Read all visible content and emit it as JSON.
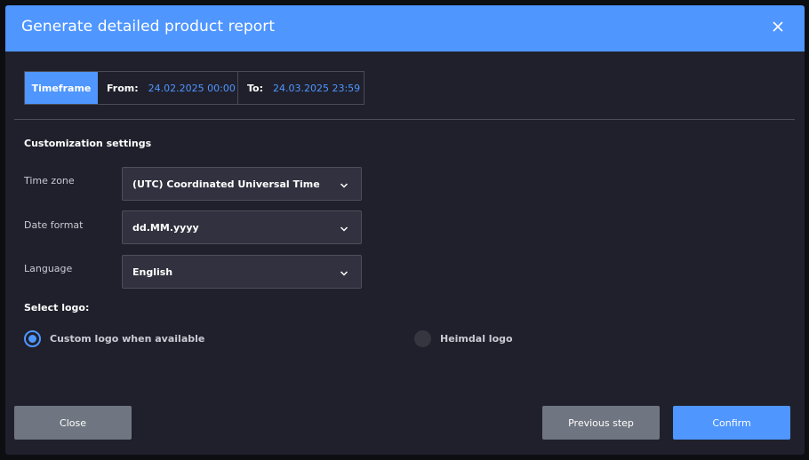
{
  "modal": {
    "title": "Generate detailed product report"
  },
  "timeframe": {
    "label": "Timeframe",
    "from_label": "From:",
    "from_value": "24.02.2025 00:00",
    "to_label": "To:",
    "to_value": "24.03.2025 23:59"
  },
  "customization": {
    "title": "Customization settings",
    "fields": [
      {
        "label": "Time zone",
        "value": "(UTC) Coordinated Universal Time"
      },
      {
        "label": "Date format",
        "value": "dd.MM.yyyy"
      },
      {
        "label": "Language",
        "value": "English"
      }
    ]
  },
  "logo": {
    "title": "Select logo:",
    "options": [
      {
        "label": "Custom logo when available",
        "selected": true
      },
      {
        "label": "Heimdal logo",
        "selected": false
      }
    ]
  },
  "buttons": {
    "close": "Close",
    "previous": "Previous step",
    "confirm": "Confirm"
  },
  "colors": {
    "accent": "#4f96ff",
    "panel": "#20202c",
    "button_grey": "#707681"
  },
  "icons": {
    "close": "close-icon",
    "dropdown": "chevron-down-icon"
  }
}
